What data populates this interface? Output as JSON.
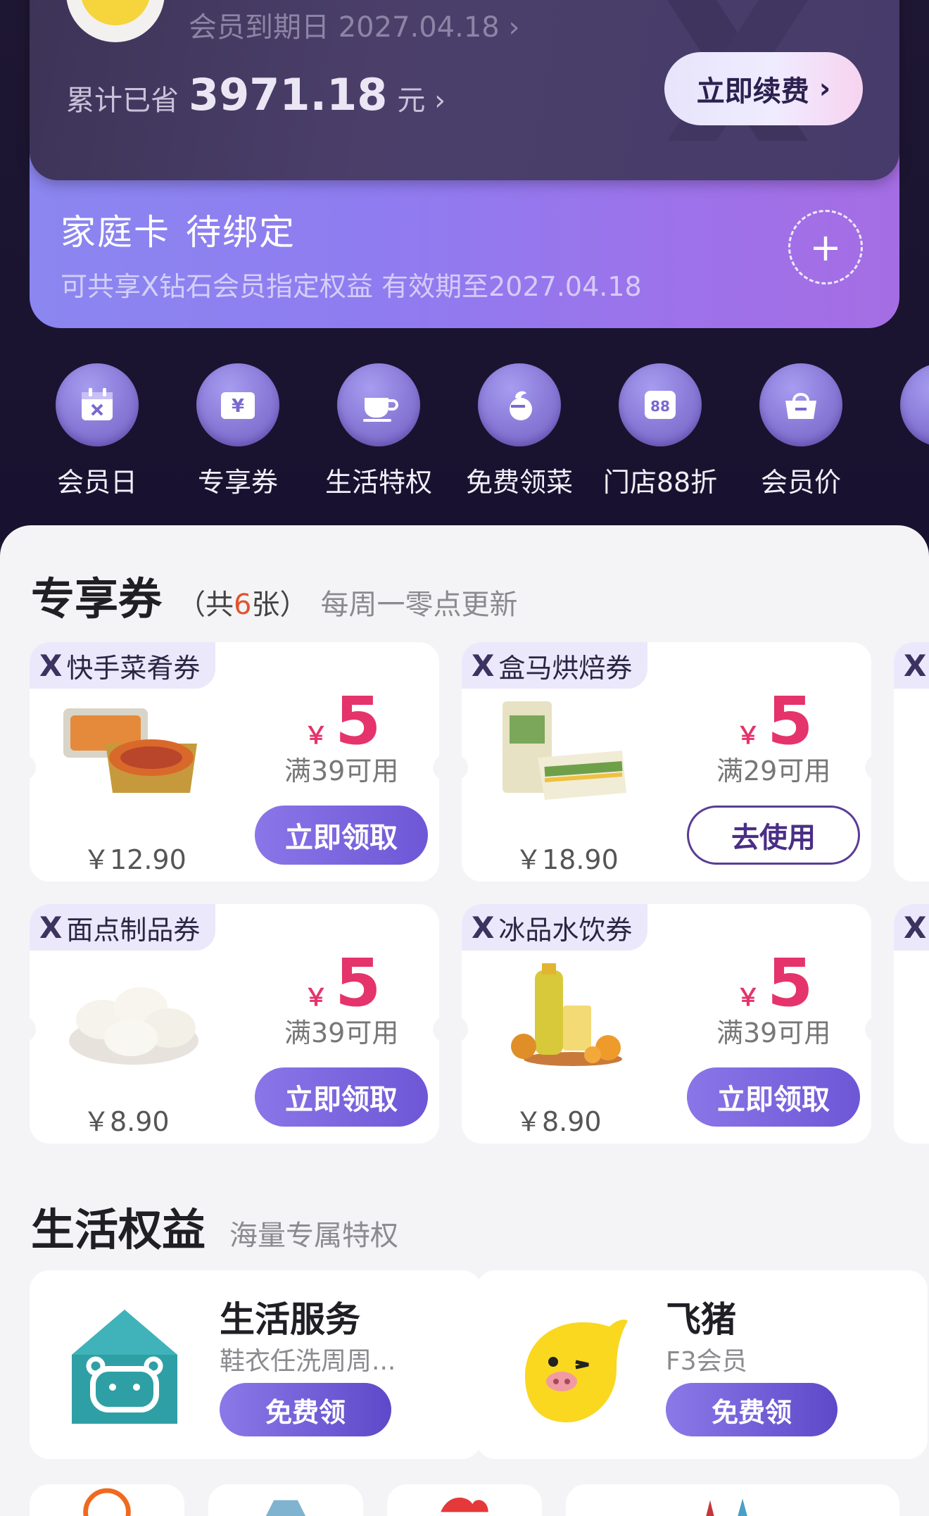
{
  "member": {
    "expire_text": "会员到期日 2027.04.18",
    "saved_label": "累计已省",
    "saved_amount": "3971.18",
    "saved_unit": "元",
    "renew_label": "立即续费"
  },
  "family_card": {
    "title": "家庭卡",
    "status": "待绑定",
    "subtitle": "可共享X钻石会员指定权益 有效期至2027.04.18"
  },
  "quick_icons": [
    {
      "label": "会员日",
      "icon": "calendar-icon"
    },
    {
      "label": "专享券",
      "icon": "coupon-icon"
    },
    {
      "label": "生活特权",
      "icon": "cup-icon"
    },
    {
      "label": "免费领菜",
      "icon": "vegetable-icon"
    },
    {
      "label": "门店88折",
      "icon": "discount-88-icon"
    },
    {
      "label": "会员价",
      "icon": "basket-icon"
    }
  ],
  "coupons_section": {
    "title": "专享券",
    "count_prefix": "（共",
    "count": "6",
    "count_suffix": "张）",
    "desc": "每周一零点更新"
  },
  "coupons": [
    {
      "tag": "快手菜肴券",
      "price": "￥12.90",
      "currency": "￥",
      "value": "5",
      "condition": "满39可用",
      "button": "立即领取",
      "button_style": "fill"
    },
    {
      "tag": "盒马烘焙券",
      "price": "￥18.90",
      "currency": "￥",
      "value": "5",
      "condition": "满29可用",
      "button": "去使用",
      "button_style": "outline"
    },
    {
      "tag": "面点制品券",
      "price": "￥8.90",
      "currency": "￥",
      "value": "5",
      "condition": "满39可用",
      "button": "立即领取",
      "button_style": "fill"
    },
    {
      "tag": "冰品水饮券",
      "price": "￥8.90",
      "currency": "￥",
      "value": "5",
      "condition": "满39可用",
      "button": "立即领取",
      "button_style": "fill"
    }
  ],
  "coupon_x_mark": "X",
  "life_section": {
    "title": "生活权益",
    "desc": "海量专属特权"
  },
  "benefits": [
    {
      "name": "生活服务",
      "desc": "鞋衣任洗周周...",
      "button": "免费领"
    },
    {
      "name": "飞猪",
      "desc": "F3会员",
      "button": "免费领"
    }
  ],
  "colors": {
    "accent_purple": "#6e57d6",
    "coupon_red": "#e5336b",
    "dark_bg": "#1c1631"
  }
}
